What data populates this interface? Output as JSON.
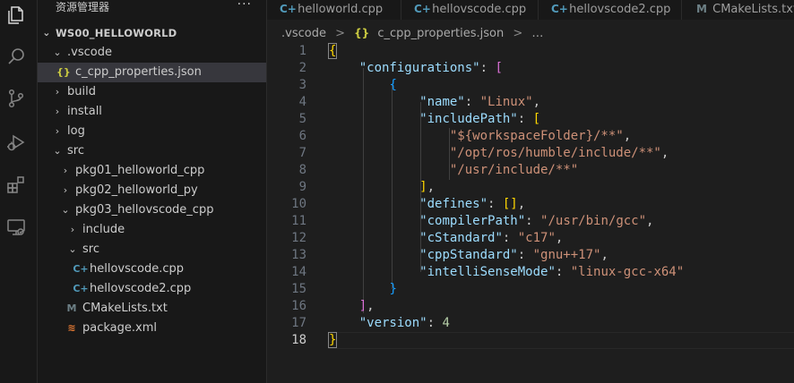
{
  "explorer": {
    "title": "资源管理器",
    "more": "···",
    "items": [
      {
        "label": "WS00_HELLOWORLD",
        "chevron": "⌄",
        "icon": ""
      },
      {
        "label": ".vscode",
        "chevron": "⌄",
        "icon": ""
      },
      {
        "label": "c_cpp_properties.json",
        "chevron": "",
        "icon": "{}"
      },
      {
        "label": "build",
        "chevron": "›",
        "icon": ""
      },
      {
        "label": "install",
        "chevron": "›",
        "icon": ""
      },
      {
        "label": "log",
        "chevron": "›",
        "icon": ""
      },
      {
        "label": "src",
        "chevron": "⌄",
        "icon": ""
      },
      {
        "label": "pkg01_helloworld_cpp",
        "chevron": "›",
        "icon": ""
      },
      {
        "label": "pkg02_helloworld_py",
        "chevron": "›",
        "icon": ""
      },
      {
        "label": "pkg03_hellovscode_cpp",
        "chevron": "⌄",
        "icon": ""
      },
      {
        "label": "include",
        "chevron": "›",
        "icon": ""
      },
      {
        "label": "src",
        "chevron": "⌄",
        "icon": ""
      },
      {
        "label": "hellovscode.cpp",
        "chevron": "",
        "icon": "C+"
      },
      {
        "label": "hellovscode2.cpp",
        "chevron": "",
        "icon": "C+"
      },
      {
        "label": "CMakeLists.txt",
        "chevron": "",
        "icon": "M"
      },
      {
        "label": "package.xml",
        "chevron": "",
        "icon": "≋"
      }
    ]
  },
  "tabs": [
    {
      "label": "helloworld.cpp",
      "icon": "C+"
    },
    {
      "label": "hellovscode.cpp",
      "icon": "C+"
    },
    {
      "label": "hellovscode2.cpp",
      "icon": "C+"
    },
    {
      "label": "CMakeLists.txt",
      "icon": "M"
    }
  ],
  "breadcrumb": {
    "folder": ".vscode",
    "sep": ">",
    "file_icon": "{}",
    "file": "c_cpp_properties.json",
    "tail": "…"
  },
  "editor": {
    "active_line": 18,
    "line_numbers": [
      "1",
      "2",
      "3",
      "4",
      "5",
      "6",
      "7",
      "8",
      "9",
      "10",
      "11",
      "12",
      "13",
      "14",
      "15",
      "16",
      "17",
      "18"
    ],
    "code": {
      "configurations_key": "\"configurations\"",
      "name_key": "\"name\"",
      "name_val": "\"Linux\"",
      "includePath_key": "\"includePath\"",
      "inc1": "\"${workspaceFolder}/**\"",
      "inc2": "\"/opt/ros/humble/include/**\"",
      "inc3": "\"/usr/include/**\"",
      "defines_key": "\"defines\"",
      "compilerPath_key": "\"compilerPath\"",
      "compilerPath_val": "\"/usr/bin/gcc\"",
      "cStandard_key": "\"cStandard\"",
      "cStandard_val": "\"c17\"",
      "cppStandard_key": "\"cppStandard\"",
      "cppStandard_val": "\"gnu++17\"",
      "intelliSenseMode_key": "\"intelliSenseMode\"",
      "intelliSenseMode_val": "\"linux-gcc-x64\"",
      "version_key": "\"version\"",
      "version_val": "4"
    }
  },
  "activity_icons": [
    "files-icon",
    "search-icon",
    "source-control-icon",
    "run-debug-icon",
    "extensions-icon",
    "remote-explorer-icon"
  ],
  "colors": {
    "key": "#9cdcfe",
    "string": "#ce9178",
    "number": "#b5cea8",
    "bracket1": "#ffd700",
    "bracket2": "#da70d6",
    "bracket3": "#179fff",
    "cpp_icon": "#519aba",
    "json_icon": "#cbcb41",
    "cmake_icon": "#6d8086",
    "xml_icon": "#e37933"
  }
}
